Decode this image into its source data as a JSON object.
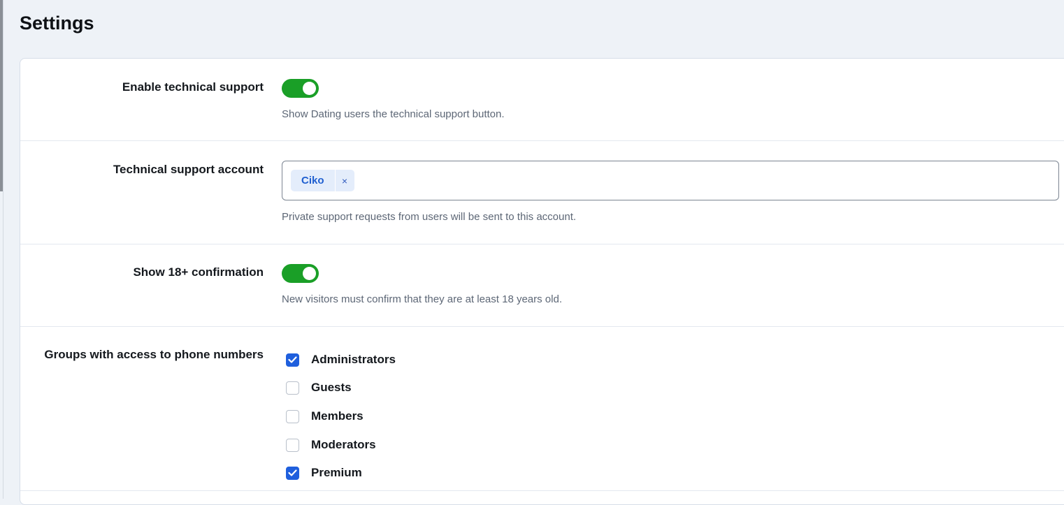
{
  "page": {
    "title": "Settings"
  },
  "settings": {
    "tech_support": {
      "label": "Enable technical support",
      "enabled": true,
      "help": "Show Dating users the technical support button."
    },
    "support_account": {
      "label": "Technical support account",
      "tags": [
        "Ciko"
      ],
      "remove_symbol": "×",
      "help": "Private support requests from users will be sent to this account."
    },
    "age_confirmation": {
      "label": "Show 18+ confirmation",
      "enabled": true,
      "help": "New visitors must confirm that they are at least 18 years old."
    },
    "phone_access": {
      "label": "Groups with access to phone numbers",
      "groups": [
        {
          "label": "Administrators",
          "checked": true
        },
        {
          "label": "Guests",
          "checked": false
        },
        {
          "label": "Members",
          "checked": false
        },
        {
          "label": "Moderators",
          "checked": false
        },
        {
          "label": "Premium",
          "checked": true
        }
      ]
    }
  },
  "colors": {
    "toggle_on": "#1a9f27",
    "checkbox_checked": "#1f5fdd",
    "tag_background": "#e4edfb",
    "tag_text": "#1f5fd0"
  }
}
